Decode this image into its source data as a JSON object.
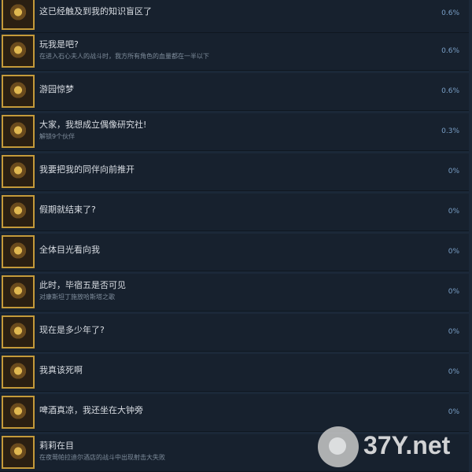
{
  "achievements": [
    {
      "title": "这已经触及到我的知识盲区了",
      "desc": "",
      "percent": "0.6%",
      "icon": "books-icon"
    },
    {
      "title": "玩我是吧?",
      "desc": "在进入石心夫人的战斗时，我方所有角色的血量都在一半以下",
      "percent": "0.6%",
      "icon": "screaming-face-icon"
    },
    {
      "title": "游园惊梦",
      "desc": "",
      "percent": "0.6%",
      "icon": "circus-tent-icon"
    },
    {
      "title": "大家，我想成立偶像研究社!",
      "desc": "解锁9个伙伴",
      "percent": "0.3%",
      "icon": "group-nine-icon"
    },
    {
      "title": "我要把我的同伴向前推开",
      "desc": "",
      "percent": "0%",
      "icon": "smoke-swirl-icon"
    },
    {
      "title": "假期就结束了?",
      "desc": "",
      "percent": "0%",
      "icon": "train-icon"
    },
    {
      "title": "全体目光看向我",
      "desc": "",
      "percent": "0%",
      "icon": "portrait-icon"
    },
    {
      "title": "此时，毕宿五是否可见",
      "desc": "对康斯坦丁施放哈斯塔之歌",
      "percent": "0%",
      "icon": "constellation-icon"
    },
    {
      "title": "现在是多少年了?",
      "desc": "",
      "percent": "0%",
      "icon": "calendar-icon"
    },
    {
      "title": "我真该死啊",
      "desc": "",
      "percent": "0%",
      "icon": "girl-portrait-icon"
    },
    {
      "title": "啤酒真凉，我还坐在大钟旁",
      "desc": "",
      "percent": "0%",
      "icon": "beer-mug-icon"
    },
    {
      "title": "莉莉在目",
      "desc": "在夜莺帕拉迪尔酒店的战斗中出现射击大失败",
      "percent": "",
      "icon": "ammo-counter-icon"
    }
  ],
  "watermark": {
    "text": "37Y.net"
  }
}
